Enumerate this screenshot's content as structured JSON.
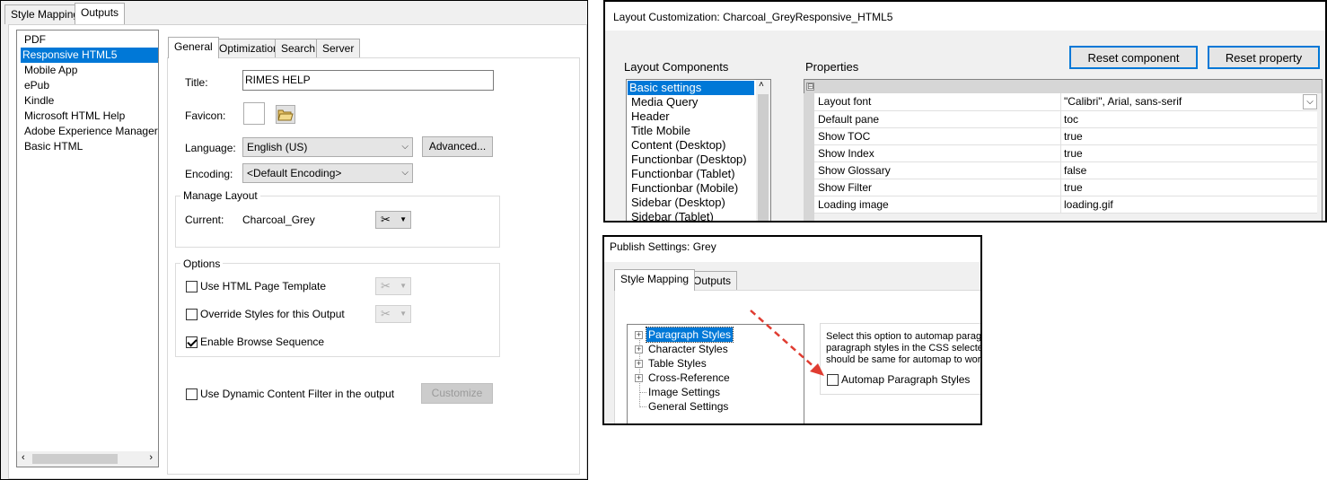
{
  "left_window": {
    "tabs": [
      "Style Mapping",
      "Outputs"
    ],
    "active_tab": "Outputs",
    "outputs_list": [
      "PDF",
      "Responsive HTML5",
      "Mobile App",
      "ePub",
      "Kindle",
      "Microsoft HTML Help",
      "Adobe Experience Manager Mo",
      "Basic HTML"
    ],
    "selected_output": "Responsive HTML5",
    "subtabs": [
      "General",
      "Optimization",
      "Search",
      "Server"
    ],
    "active_subtab": "General",
    "title_label": "Title:",
    "title_value": "RIMES HELP",
    "favicon_label": "Favicon:",
    "language_label": "Language:",
    "language_value": "English (US)",
    "advanced_button": "Advanced...",
    "encoding_label": "Encoding:",
    "encoding_value": "<Default Encoding>",
    "manage_layout_title": "Manage Layout",
    "current_label": "Current:",
    "current_value": "Charcoal_Grey",
    "options_title": "Options",
    "use_html_template": "Use HTML Page Template",
    "override_styles": "Override Styles for this Output",
    "enable_browse": "Enable Browse Sequence",
    "dynamic_filter": "Use Dynamic Content Filter in the output",
    "customize_button": "Customize"
  },
  "layout_window": {
    "title": "Layout Customization: Charcoal_GreyResponsive_HTML5",
    "reset_component": "Reset component",
    "reset_property": "Reset property",
    "components_label": "Layout Components",
    "properties_label": "Properties",
    "components": [
      "Basic settings",
      "Media Query",
      "Header",
      "Title Mobile",
      "Content (Desktop)",
      "Functionbar (Desktop)",
      "Functionbar (Tablet)",
      "Functionbar (Mobile)",
      "Sidebar (Desktop)",
      "Sidebar (Tablet)"
    ],
    "selected_component": "Basic settings",
    "collapse_glyph": "⊟",
    "properties": [
      {
        "key": "Layout font",
        "value": "\"Calibri\", Arial, sans-serif"
      },
      {
        "key": "Default pane",
        "value": "toc"
      },
      {
        "key": "Show TOC",
        "value": "true"
      },
      {
        "key": "Show Index",
        "value": "true"
      },
      {
        "key": "Show Glossary",
        "value": "false"
      },
      {
        "key": "Show Filter",
        "value": "true"
      },
      {
        "key": "Loading image",
        "value": "loading.gif"
      }
    ]
  },
  "publish_window": {
    "title": "Publish Settings: Grey",
    "tabs": [
      "Style Mapping",
      "Outputs"
    ],
    "active_tab": "Style Mapping",
    "tree": [
      {
        "label": "Paragraph Styles",
        "expandable": true,
        "selected": true
      },
      {
        "label": "Character Styles",
        "expandable": true,
        "selected": false
      },
      {
        "label": "Table Styles",
        "expandable": true,
        "selected": false
      },
      {
        "label": "Cross-Reference",
        "expandable": true,
        "selected": false
      },
      {
        "label": "Image Settings",
        "expandable": false,
        "selected": false
      },
      {
        "label": "General Settings",
        "expandable": false,
        "selected": false
      }
    ],
    "description": [
      "Select this option to automap paragra",
      "paragraph styles in the CSS selected",
      "should be same for automap to work."
    ],
    "automap_label": "Automap Paragraph Styles"
  },
  "colors": {
    "selection": "#0078d7",
    "annotation_arrow": "#e03c31"
  }
}
